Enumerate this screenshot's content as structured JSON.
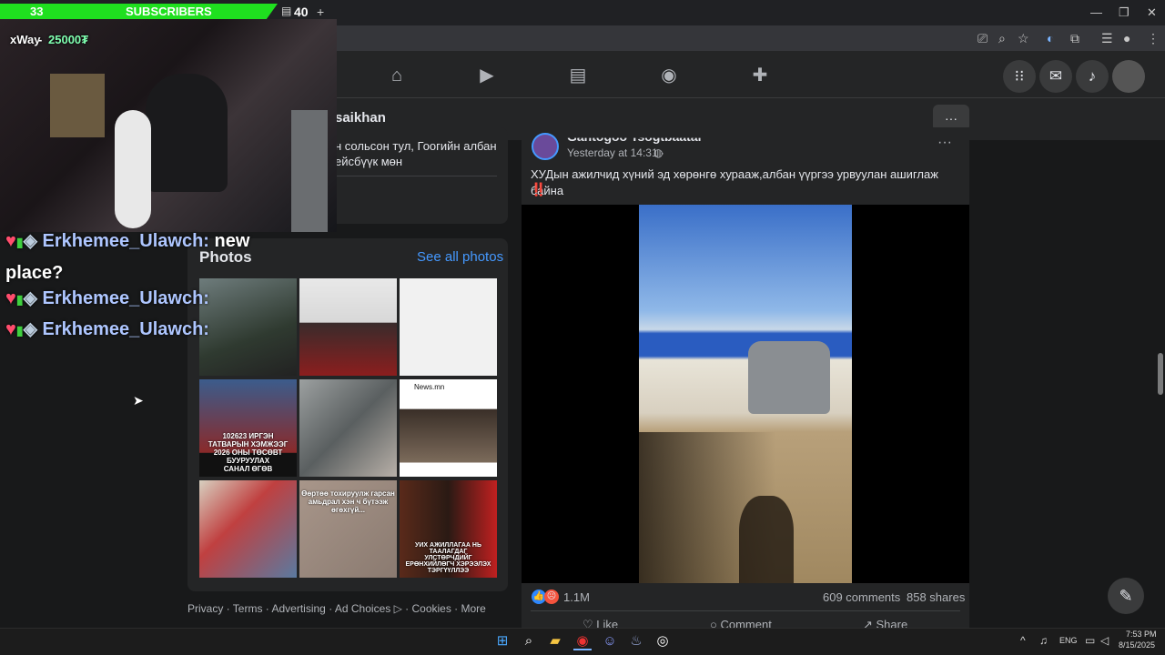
{
  "overlay": {
    "sub_count": "33",
    "sub_label": "SUBSCRIBERS",
    "goal": "40",
    "goal_plus": "+",
    "donor": "xWay",
    "donor_sep": " - ",
    "donor_amount": "25000₮",
    "chat": [
      {
        "user": "Erkhemee_Ulawch:",
        "msg": "new place?"
      },
      {
        "user": "Erkhemee_Ulawch:",
        "msg": ""
      },
      {
        "user": "Erkhemee_Ulawch:",
        "msg": ""
      }
    ]
  },
  "window": {
    "minimize": "—",
    "restore": "❐",
    "close": "✕"
  },
  "fb": {
    "profile_name": "saikhan",
    "more": "···",
    "about_text": "н сольсон тул, Гоогийн албан\nейсбүүк мөн",
    "photos": {
      "title": "Photos",
      "see_all": "See all photos",
      "labels": [
        "",
        "",
        "",
        "102623 ИРГЭН\nТАТВАРЫН ХЭМЖЭЭГ\n2026 ОНЫ ТӨСӨВТ БУУРУУЛАХ\nСАНАЛ ӨГӨВ",
        "",
        "News.mn",
        "",
        "Өөртөө тохируулж гарсан\nамьдрал хэн ч бүтээж\nөгөхгүй...",
        "УИХ АЖИЛЛАГАА НЬ ТААЛАГДАГ\nУЛСТӨРЧДИЙГ ЕРӨНХИЙЛӨГЧ ХЭРЭЭЛЭХ\nТЭРГҮҮЛЛЭЭ"
      ]
    },
    "footer": [
      "Privacy",
      "Terms",
      "Advertising",
      "Ad Choices ▷",
      "Cookies",
      "More"
    ],
    "post": {
      "author": "Gantogoo Tsogtbaatar",
      "time": "Yesterday at 14:31 ·",
      "text": "ХУДын ажилчид хүний эд хөрөнгө хурааж,албан үүргээ урвуулан ашиглаж  байна",
      "emoji": "‼️",
      "reactions": "1.1M",
      "comments": "609 comments",
      "shares": "858 shares",
      "actions": [
        "Like",
        "Comment",
        "Share"
      ]
    }
  },
  "taskbar": {
    "lang": "ENG",
    "time": "7:53 PM",
    "date": "8/15/2025",
    "caret": "^"
  },
  "colors": {
    "accent": "#4599ff",
    "green": "#1fe01f"
  }
}
